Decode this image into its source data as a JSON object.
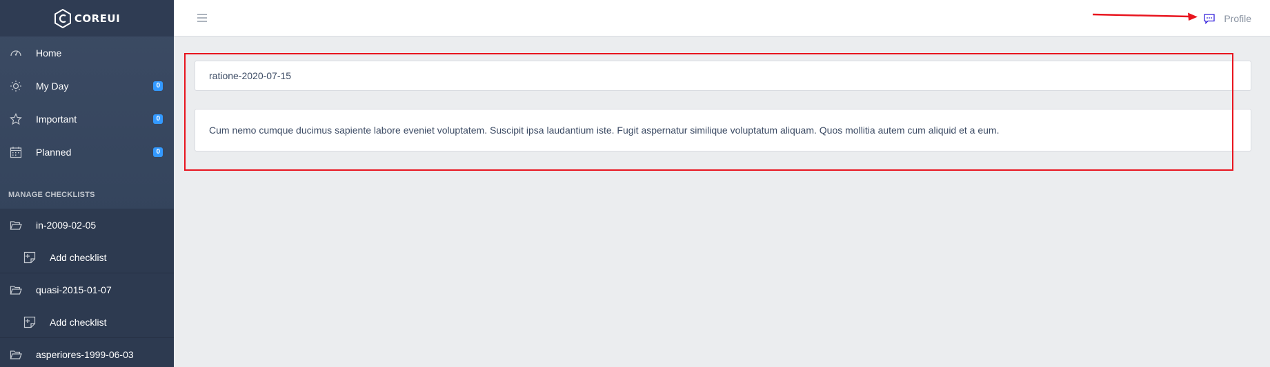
{
  "brand": {
    "name": "COREUI"
  },
  "sidebar": {
    "nav": [
      {
        "label": "Home",
        "icon": "speedometer-icon",
        "badge": ""
      },
      {
        "label": "My Day",
        "icon": "sun-icon",
        "badge": "0"
      },
      {
        "label": "Important",
        "icon": "star-icon",
        "badge": "0"
      },
      {
        "label": "Planned",
        "icon": "calendar-icon",
        "badge": "0"
      }
    ],
    "section_title": "MANAGE CHECKLISTS",
    "checklists": [
      {
        "label": "in-2009-02-05",
        "add_label": "Add checklist"
      },
      {
        "label": "quasi-2015-01-07",
        "add_label": "Add checklist"
      },
      {
        "label": "asperiores-1999-06-03"
      }
    ]
  },
  "header": {
    "toggler_icon": "hamburger-icon",
    "profile_label": "Profile",
    "chat_icon": "chat-icon"
  },
  "main": {
    "checklist_title": "ratione-2020-07-15",
    "checklist_description": "Cum nemo cumque ducimus sapiente labore eveniet voluptatem. Suscipit ipsa laudantium iste. Fugit aspernatur similique voluptatum aliquam. Quos mollitia autem cum aliquid et a eum."
  },
  "colors": {
    "sidebar_bg": "#3c4b64",
    "badge": "#3399ff",
    "annotation": "#e8141e",
    "link": "#321fdb"
  }
}
